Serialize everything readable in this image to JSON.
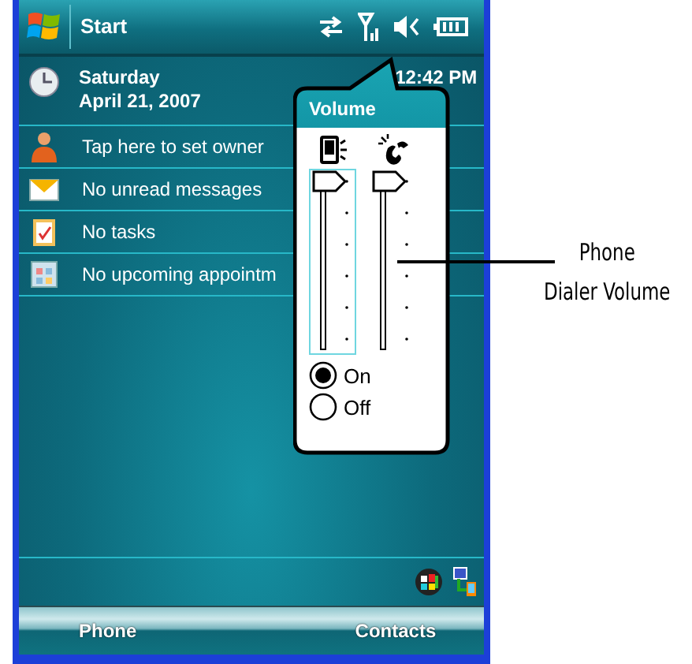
{
  "title_bar": {
    "start": "Start"
  },
  "date_row": {
    "day": "Saturday",
    "date": "April 21, 2007",
    "time": "12:42 PM"
  },
  "today_items": [
    {
      "kind": "owner",
      "text": "Tap here to set owner"
    },
    {
      "kind": "messages",
      "text": "No unread messages"
    },
    {
      "kind": "tasks",
      "text": "No tasks"
    },
    {
      "kind": "calendar",
      "text": "No upcoming appointm"
    }
  ],
  "volume_popup": {
    "title": "Volume",
    "sliders": [
      {
        "kind": "device",
        "level": 1,
        "selected": true
      },
      {
        "kind": "phone",
        "level": 1,
        "selected": false
      }
    ],
    "options": [
      {
        "label": "On",
        "selected": true
      },
      {
        "label": "Off",
        "selected": false
      }
    ]
  },
  "softkeys": [
    "Phone",
    "Contacts"
  ],
  "callout": {
    "lines": [
      "Phone",
      "Dialer Volume"
    ]
  }
}
